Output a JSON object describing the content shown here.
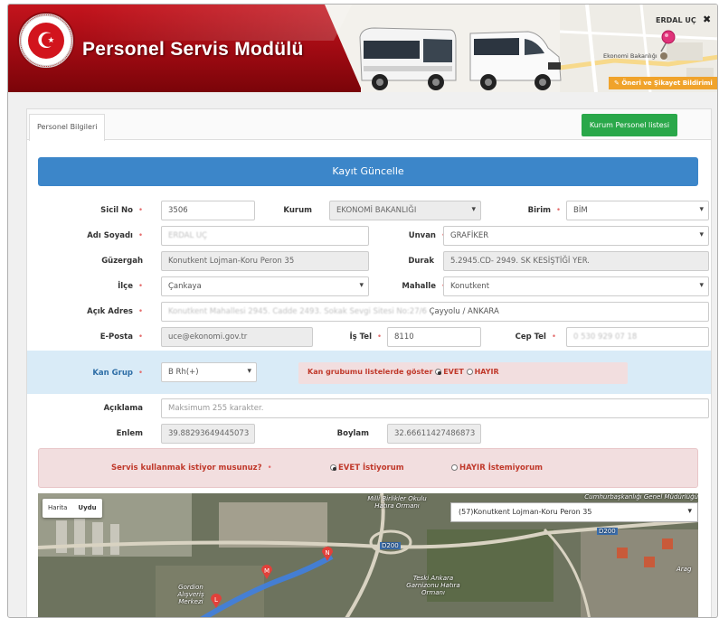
{
  "header": {
    "title": "Personel Servis Modülü",
    "user": "ERDAL UÇ",
    "close_icon": "close-icon",
    "map_pin_label": "Ekonomi Bakanlığı",
    "feedback_label": "Öneri ve Şikayet Bildirimi"
  },
  "tabs": {
    "active": "Personel Bilgileri"
  },
  "actions": {
    "list_button": "Kurum Personel listesi"
  },
  "form": {
    "banner": "Kayıt Güncelle",
    "sicil_label": "Sicil No",
    "sicil_value": "3506",
    "kurum_label": "Kurum",
    "kurum_value": "EKONOMİ BAKANLIĞI",
    "birim_label": "Birim",
    "birim_value": "BİM",
    "ad_label": "Adı Soyadı",
    "ad_value": "ERDAL UÇ",
    "unvan_label": "Unvan",
    "unvan_value": "GRAFİKER",
    "guzergah_label": "Güzergah",
    "guzergah_value": "Konutkent Lojman-Koru Peron 35",
    "durak_label": "Durak",
    "durak_value": "5.2945.CD- 2949. SK KESİŞTİĞİ YER.",
    "ilce_label": "İlçe",
    "ilce_value": "Çankaya",
    "mahalle_label": "Mahalle",
    "mahalle_value": "Konutkent",
    "adres_label": "Açık Adres",
    "adres_blur": "Konutkent Mahallesi 2945. Cadde 2493. Sokak Sevgi Sitesi No:27/6",
    "adres_value": "Çayyolu / ANKARA",
    "eposta_label": "E-Posta",
    "eposta_value": "uce@ekonomi.gov.tr",
    "istel_label": "İş Tel",
    "istel_value": "8110",
    "ceptel_label": "Cep Tel",
    "ceptel_value": "0 530 929 07 18",
    "kan_label": "Kan Grup",
    "kan_value": "B Rh(+)",
    "kan_show_label": "Kan grubumu listelerde göster",
    "kan_show_yes": "EVET",
    "kan_show_no": "HAYIR",
    "aciklama_label": "Açıklama",
    "aciklama_placeholder": "Maksimum 255 karakter.",
    "enlem_label": "Enlem",
    "enlem_value": "39.88293649445073",
    "boylam_label": "Boylam",
    "boylam_value": "32.66611427486873",
    "servis_question": "Servis kullanmak istiyor musunuz?",
    "servis_yes": "EVET İstiyorum",
    "servis_no": "HAYIR İstemiyorum",
    "required_mark": "•"
  },
  "map": {
    "type_map": "Harita",
    "type_sat": "Uydu",
    "route_select": "(57)Konutkent Lojman-Koru Peron 35",
    "labels": {
      "milli": "Milli Birlikler Okulu Hatıra Ormanı",
      "teski": "Teski Ankara Garnizonu Hatıra Ormanı",
      "gordion": "Gordion Alışveriş Merkezi",
      "road": "D200",
      "top_right": "Cumhurbaşkanlığı Genel Müdürlüğü",
      "arag": "Arag"
    }
  },
  "colors": {
    "header_red": "#b3111a",
    "banner_blue": "#3c86c9",
    "button_green": "#2aa84a",
    "required_red": "#e56d6d",
    "feedback_orange": "#f0a32b"
  }
}
